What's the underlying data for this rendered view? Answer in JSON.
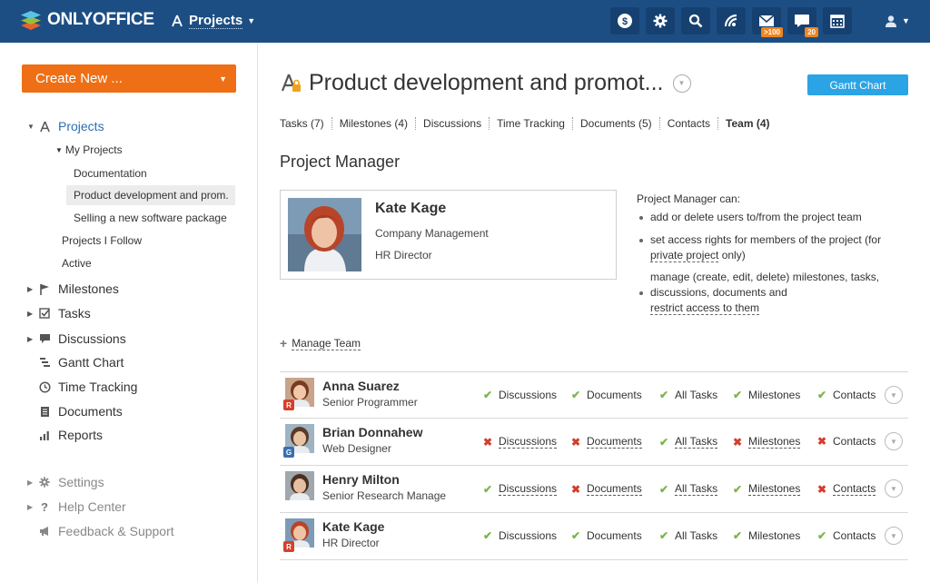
{
  "header": {
    "logo": "ONLYOFFICE",
    "module": "Projects",
    "icons": [
      "payment-icon",
      "settings-icon",
      "search-icon",
      "feed-icon",
      "mail-icon",
      "talk-icon",
      "calendar-icon"
    ],
    "mail_badge": ">100",
    "talk_badge": "20"
  },
  "sidebar": {
    "create_new": "Create New ...",
    "projects": "Projects",
    "my_projects": "My Projects",
    "my_projects_items": [
      "Documentation",
      "Product development and prom.",
      "Selling a new software package"
    ],
    "projects_i_follow": "Projects I Follow",
    "active": "Active",
    "milestones": "Milestones",
    "tasks": "Tasks",
    "discussions": "Discussions",
    "gantt_chart": "Gantt Chart",
    "time_tracking": "Time Tracking",
    "documents": "Documents",
    "reports": "Reports",
    "settings": "Settings",
    "help_center": "Help Center",
    "feedback": "Feedback & Support"
  },
  "main": {
    "title": "Product development and promot...",
    "gantt_button": "Gantt Chart",
    "tabs": [
      "Tasks (7)",
      "Milestones (4)",
      "Discussions",
      "Time Tracking",
      "Documents (5)",
      "Contacts",
      "Team (4)"
    ],
    "section_title": "Project Manager",
    "pm": {
      "name": "Kate Kage",
      "department": "Company Management",
      "position": "HR Director"
    },
    "can": {
      "heading": "Project Manager can:",
      "item1": "add or delete users to/from the project team",
      "item2_a": "set access rights for members of the project (for",
      "item2_link": "private project",
      "item2_b": " only)",
      "item3_a": "manage (create, edit, delete) milestones, tasks,",
      "item3_b": "discussions, documents and",
      "item3_link": "restrict access to them"
    },
    "manage_team": "Manage Team",
    "members": [
      {
        "name": "Anna Suarez",
        "title": "Senior Programmer",
        "badge": "R",
        "badge_color": "#d6402b",
        "perms": [
          {
            "label": "Discussions",
            "ok": true,
            "link": false
          },
          {
            "label": "Documents",
            "ok": true,
            "link": false
          },
          {
            "label": "All Tasks",
            "ok": true,
            "link": false
          },
          {
            "label": "Milestones",
            "ok": true,
            "link": false
          },
          {
            "label": "Contacts",
            "ok": true,
            "link": false
          }
        ]
      },
      {
        "name": "Brian Donnahew",
        "title": "Web Designer",
        "badge": "G",
        "badge_color": "#3a6fb0",
        "perms": [
          {
            "label": "Discussions",
            "ok": false,
            "link": true
          },
          {
            "label": "Documents",
            "ok": false,
            "link": true
          },
          {
            "label": "All Tasks",
            "ok": true,
            "link": true
          },
          {
            "label": "Milestones",
            "ok": false,
            "link": true
          },
          {
            "label": "Contacts",
            "ok": false,
            "link": false
          }
        ]
      },
      {
        "name": "Henry Milton",
        "title": "Senior Research Manage",
        "badge": "",
        "badge_color": "",
        "perms": [
          {
            "label": "Discussions",
            "ok": true,
            "link": true
          },
          {
            "label": "Documents",
            "ok": false,
            "link": true
          },
          {
            "label": "All Tasks",
            "ok": true,
            "link": true
          },
          {
            "label": "Milestones",
            "ok": true,
            "link": true
          },
          {
            "label": "Contacts",
            "ok": false,
            "link": true
          }
        ]
      },
      {
        "name": "Kate Kage",
        "title": "HR Director",
        "badge": "R",
        "badge_color": "#d6402b",
        "perms": [
          {
            "label": "Discussions",
            "ok": true,
            "link": false
          },
          {
            "label": "Documents",
            "ok": true,
            "link": false
          },
          {
            "label": "All Tasks",
            "ok": true,
            "link": false
          },
          {
            "label": "Milestones",
            "ok": true,
            "link": false
          },
          {
            "label": "Contacts",
            "ok": true,
            "link": false
          }
        ]
      }
    ]
  }
}
